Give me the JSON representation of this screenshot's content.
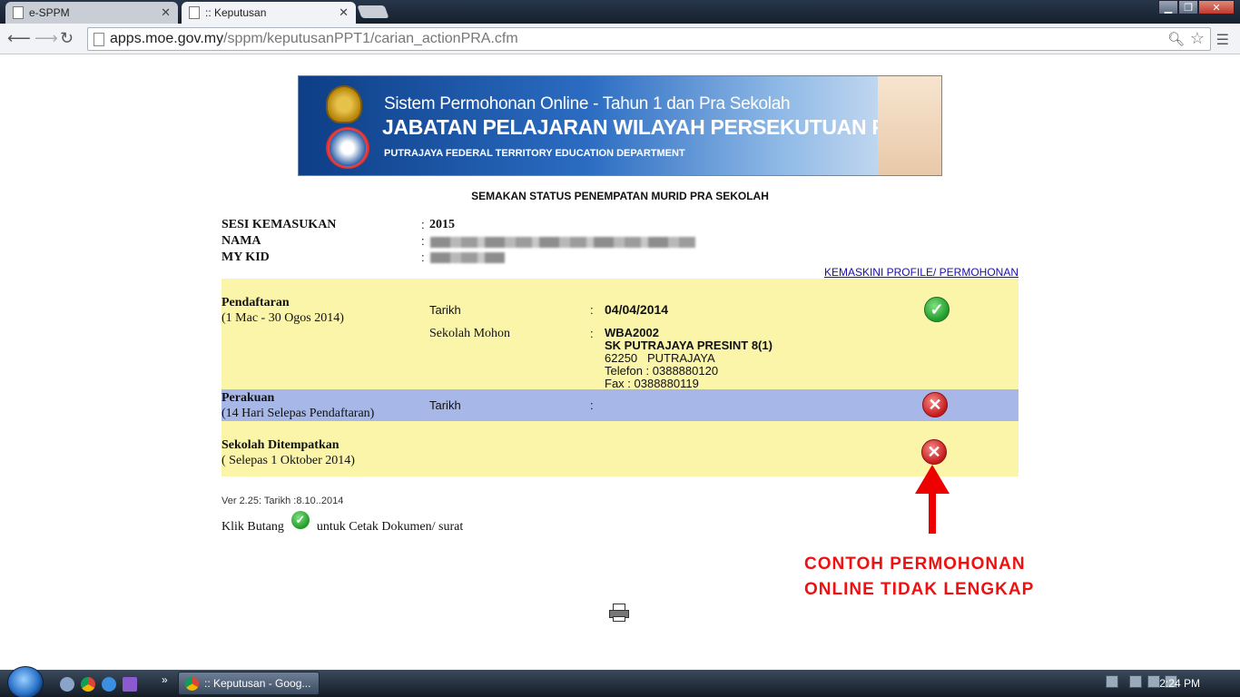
{
  "browser": {
    "tabs": [
      {
        "title": "e-SPPM"
      },
      {
        "title": ":: Keputusan"
      }
    ],
    "url_host": "apps.moe.gov.my",
    "url_path": "/sppm/keputusanPPT1/carian_actionPRA.cfm"
  },
  "banner": {
    "line1": "Sistem Permohonan Online - Tahun 1 dan Pra Sekolah",
    "line2": "JABATAN PELAJARAN WILAYAH PERSEKUTUAN PUTRAJAYA",
    "line3": "PUTRAJAYA FEDERAL TERRITORY EDUCATION DEPARTMENT"
  },
  "page_title": "SEMAKAN STATUS PENEMPATAN MURID PRA SEKOLAH",
  "info": {
    "sesi_label": "SESI KEMASUKAN",
    "sesi_value": "2015",
    "nama_label": "NAMA",
    "mykid_label": "MY KID",
    "colon": ":"
  },
  "update_link": "KEMASKINI PROFILE/ PERMOHONAN",
  "rows": [
    {
      "title": "Pendaftaran",
      "subtitle": "(1 Mac - 30 Ogos 2014)",
      "tarikh_label": "Tarikh",
      "tarikh_value": "04/04/2014",
      "sekolah_label": "Sekolah Mohon",
      "sekolah_code": "WBA2002",
      "sekolah_name": "SK PUTRAJAYA PRESINT 8(1)",
      "sekolah_addr": "62250   PUTRAJAYA",
      "sekolah_tel": "Telefon : 0388880120",
      "sekolah_fax": "Fax : 0388880119",
      "status": "ok"
    },
    {
      "title": "Perakuan",
      "subtitle": "(14 Hari Selepas Pendaftaran)",
      "tarikh_label": "Tarikh",
      "status": "no"
    },
    {
      "title": "Sekolah Ditempatkan",
      "subtitle": "( Selepas 1 Oktober 2014)",
      "status": "no"
    }
  ],
  "version": "Ver 2.25: Tarikh :8.10..2014",
  "klik": {
    "before": "Klik Butang",
    "after": "untuk Cetak Dokumen/ surat"
  },
  "annotation": {
    "line1": "CONTOH PERMOHONAN",
    "line2": "ONLINE TIDAK LENGKAP",
    "color": "#e11111"
  },
  "taskbar": {
    "task_label": ":: Keputusan - Goog...",
    "clock": "2:24 PM"
  },
  "colors": {
    "row_yellow": "#faf5a9",
    "row_blue": "#a6b7e8",
    "link": "#1a0dab"
  }
}
